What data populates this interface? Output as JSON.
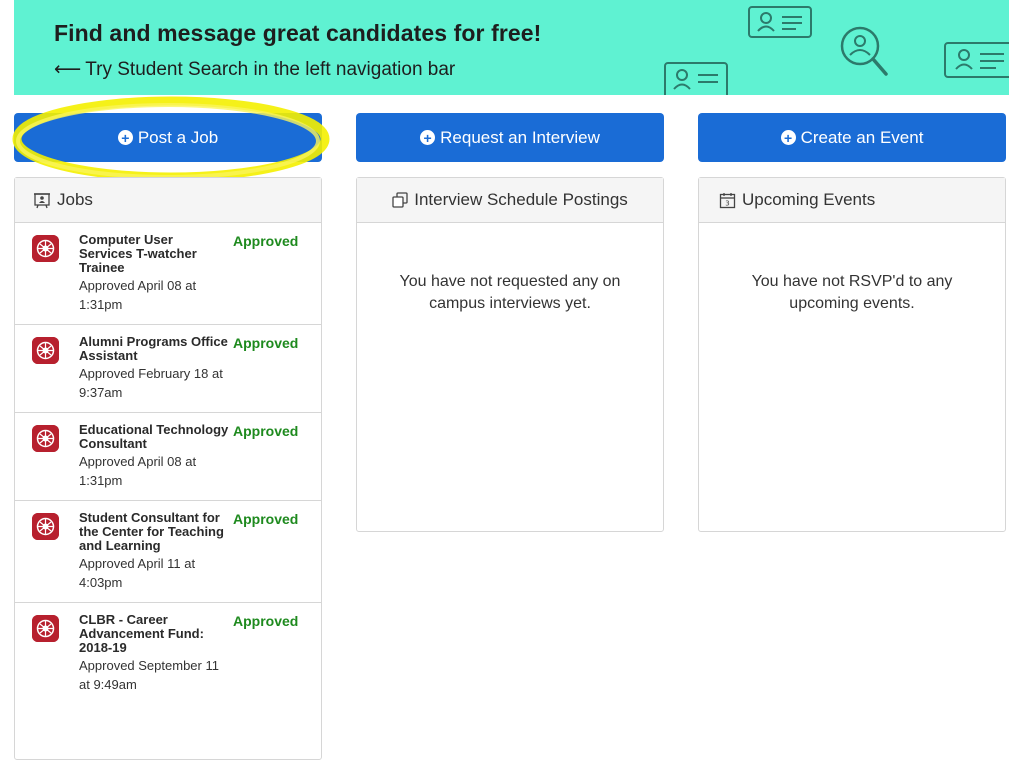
{
  "banner": {
    "title": "Find and message great candidates for free!",
    "subtitle_arrow": "⟵",
    "subtitle": "Try Student Search in the left navigation bar",
    "bg_color": "#5ff2d2"
  },
  "actions": {
    "post_job": "Post a Job",
    "request_interview": "Request an Interview",
    "create_event": "Create an Event",
    "accent_color": "#1a6cd6"
  },
  "jobs_panel": {
    "title": "Jobs",
    "icon": "jobs-icon",
    "items": [
      {
        "title": "Computer User Services T-watcher Trainee",
        "status": "Approved",
        "meta": "Approved April 08 at 1:31pm"
      },
      {
        "title": "Alumni Programs Office Assistant",
        "status": "Approved",
        "meta": "Approved February 18 at 9:37am"
      },
      {
        "title": "Educational Technology Consultant",
        "status": "Approved",
        "meta": "Approved April 08 at 1:31pm"
      },
      {
        "title": "Student Consultant for the Center for Teaching and Learning",
        "status": "Approved",
        "meta": "Approved April 11 at 4:03pm"
      },
      {
        "title": "CLBR - Career Advancement Fund: 2018-19",
        "status": "Approved",
        "meta": "Approved September 11 at 9:49am"
      }
    ],
    "status_color": "#1e8a1e"
  },
  "interviews_panel": {
    "title": "Interview Schedule Postings",
    "icon": "interview-copy-icon",
    "empty_message": "You have not requested any on campus interviews yet."
  },
  "events_panel": {
    "title": "Upcoming Events",
    "icon": "calendar-icon",
    "empty_message": "You have not RSVP'd to any upcoming events."
  }
}
